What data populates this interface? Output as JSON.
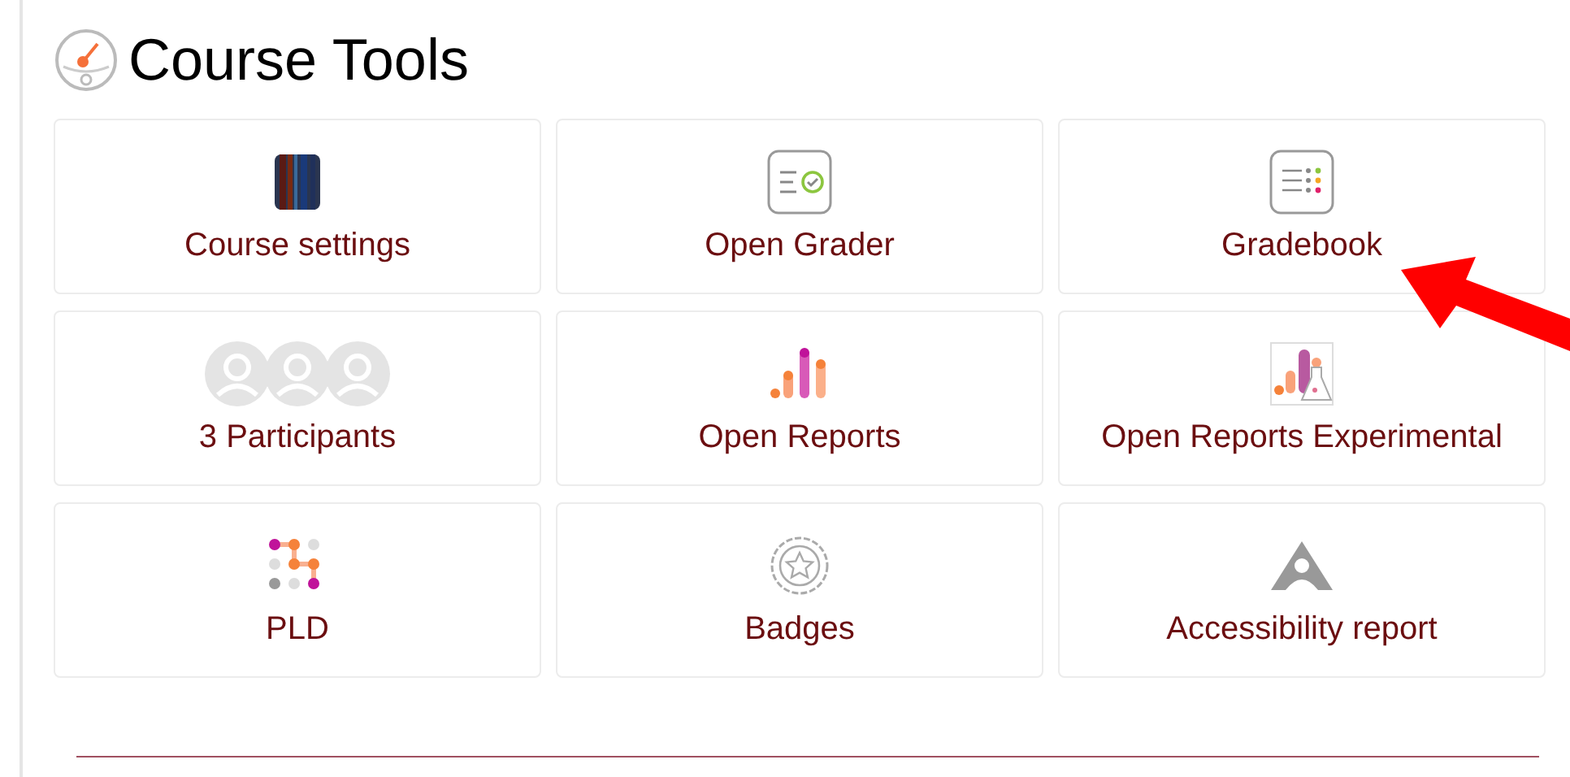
{
  "title": "Course Tools",
  "tools": [
    {
      "kind": "settings",
      "label": "Course settings"
    },
    {
      "kind": "grader",
      "label": "Open Grader"
    },
    {
      "kind": "gradebook",
      "label": "Gradebook"
    },
    {
      "kind": "participants",
      "label": "3 Participants"
    },
    {
      "kind": "reports",
      "label": "Open Reports"
    },
    {
      "kind": "experimental",
      "label": "Open Reports Experimental"
    },
    {
      "kind": "pld",
      "label": "PLD"
    },
    {
      "kind": "badges",
      "label": "Badges"
    },
    {
      "kind": "accessibility",
      "label": "Accessibility report"
    }
  ]
}
